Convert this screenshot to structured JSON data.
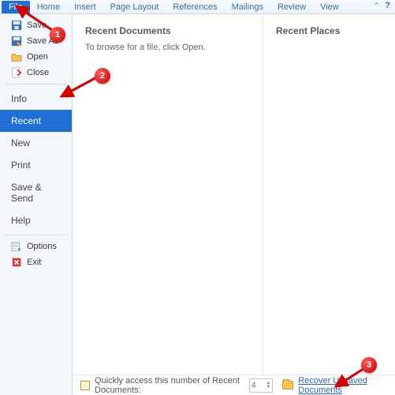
{
  "ribbon": {
    "tabs": [
      "File",
      "Home",
      "Insert",
      "Page Layout",
      "References",
      "Mailings",
      "Review",
      "View"
    ],
    "active_index": 0
  },
  "sidebar": {
    "top_items": [
      {
        "label": "Save",
        "icon": "save-icon"
      },
      {
        "label": "Save As",
        "icon": "save-as-icon"
      },
      {
        "label": "Open",
        "icon": "open-icon"
      },
      {
        "label": "Close",
        "icon": "close-icon"
      }
    ],
    "nav_items": [
      {
        "label": "Info",
        "selected": false
      },
      {
        "label": "Recent",
        "selected": true
      },
      {
        "label": "New",
        "selected": false
      },
      {
        "label": "Print",
        "selected": false
      },
      {
        "label": "Save & Send",
        "selected": false
      },
      {
        "label": "Help",
        "selected": false
      }
    ],
    "footer_items": [
      {
        "label": "Options",
        "icon": "options-icon"
      },
      {
        "label": "Exit",
        "icon": "exit-icon"
      }
    ]
  },
  "content": {
    "left_heading": "Recent Documents",
    "left_hint": "To browse for a file, click Open.",
    "right_heading": "Recent Places"
  },
  "bottom": {
    "quick_access_label": "Quickly access this number of Recent Documents:",
    "quick_access_value": "4",
    "recover_label": "Recover Unsaved Documents"
  },
  "callouts": {
    "c1": "1",
    "c2": "2",
    "c3": "3"
  }
}
